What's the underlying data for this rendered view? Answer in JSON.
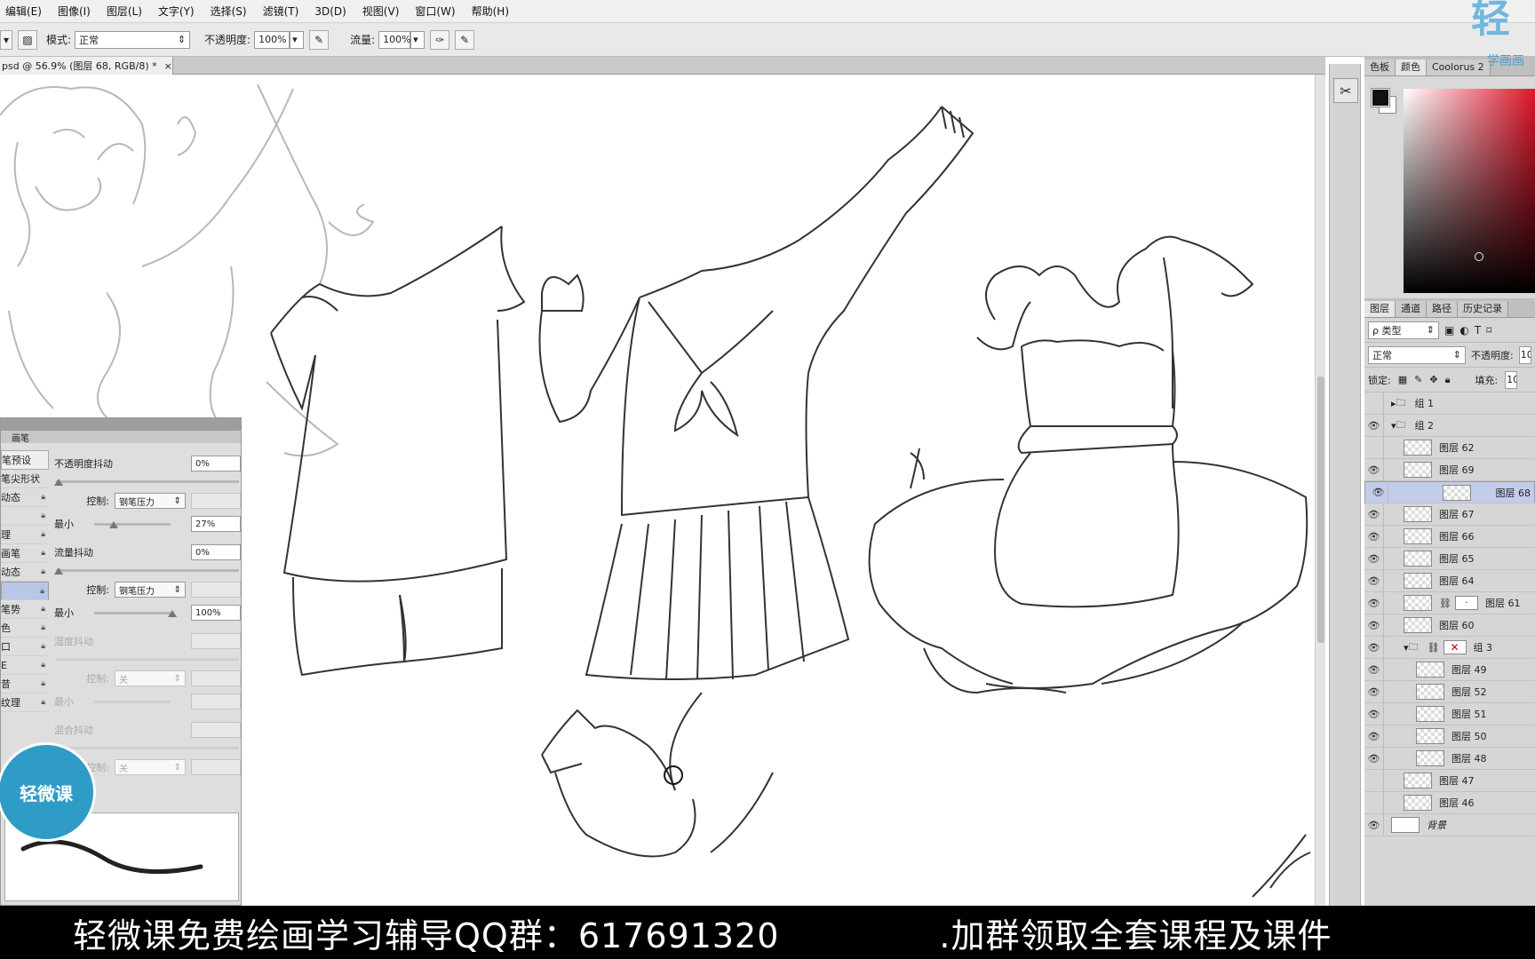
{
  "menu": [
    "编辑(E)",
    "图像(I)",
    "图层(L)",
    "文字(Y)",
    "选择(S)",
    "滤镜(T)",
    "3D(D)",
    "视图(V)",
    "窗口(W)",
    "帮助(H)"
  ],
  "options": {
    "mode_label": "模式:",
    "mode_value": "正常",
    "opacity_label": "不透明度:",
    "opacity_value": "100%",
    "flow_label": "流量:",
    "flow_value": "100%"
  },
  "document_tab": {
    "title": "psd @ 56.9% (图层 68, RGB/8) *",
    "close": "×"
  },
  "color_panel": {
    "tabs": [
      "色板",
      "颜色",
      "Coolorus 2"
    ],
    "active_tab": 1,
    "fg_color": "#111111",
    "bg_color": "#ffffff",
    "hue_color": "#e0152a"
  },
  "layers_panel": {
    "tabs": [
      "图层",
      "通道",
      "路径",
      "历史记录"
    ],
    "filter_label": "ρ 类型",
    "blend_mode": "正常",
    "opacity_label": "不透明度:",
    "opacity_value": "10",
    "lock_label": "锁定:",
    "fill_label": "填充:",
    "fill_value": "10",
    "layers": [
      {
        "name": "组 1",
        "type": "group",
        "visible": false,
        "indent": 0,
        "expanded": false
      },
      {
        "name": "组 2",
        "type": "group",
        "visible": true,
        "indent": 0,
        "expanded": true
      },
      {
        "name": "图层 62",
        "type": "layer",
        "visible": false,
        "indent": 1
      },
      {
        "name": "图层 69",
        "type": "layer",
        "visible": true,
        "indent": 1
      },
      {
        "name": "图层 68",
        "type": "layer",
        "visible": true,
        "indent": 1,
        "selected": true
      },
      {
        "name": "图层 67",
        "type": "layer",
        "visible": true,
        "indent": 1
      },
      {
        "name": "图层 66",
        "type": "layer",
        "visible": true,
        "indent": 1
      },
      {
        "name": "图层 65",
        "type": "layer",
        "visible": true,
        "indent": 1
      },
      {
        "name": "图层 64",
        "type": "layer",
        "visible": true,
        "indent": 1
      },
      {
        "name": "图层 61",
        "type": "masked",
        "visible": true,
        "indent": 1
      },
      {
        "name": "图层 60",
        "type": "layer",
        "visible": true,
        "indent": 1
      },
      {
        "name": "组 3",
        "type": "group-masked",
        "visible": true,
        "indent": 1,
        "expanded": true
      },
      {
        "name": "图层 49",
        "type": "layer",
        "visible": true,
        "indent": 2
      },
      {
        "name": "图层 52",
        "type": "layer",
        "visible": true,
        "indent": 2
      },
      {
        "name": "图层 51",
        "type": "layer",
        "visible": true,
        "indent": 2
      },
      {
        "name": "图层 50",
        "type": "layer",
        "visible": true,
        "indent": 2
      },
      {
        "name": "图层 48",
        "type": "layer",
        "visible": true,
        "indent": 2
      },
      {
        "name": "图层 47",
        "type": "layer",
        "visible": false,
        "indent": 1
      },
      {
        "name": "图层 46",
        "type": "layer",
        "visible": false,
        "indent": 1
      },
      {
        "name": "背景",
        "type": "background",
        "visible": true,
        "indent": 0
      }
    ]
  },
  "brush_panel": {
    "tab": "画笔",
    "preset_button": "笔预设",
    "categories": [
      {
        "label": "笔尖形状",
        "lock": false
      },
      {
        "label": "动态",
        "lock": true
      },
      {
        "label": "",
        "lock": true
      },
      {
        "label": "理",
        "lock": true
      },
      {
        "label": "画笔",
        "lock": true
      },
      {
        "label": "动态",
        "lock": true
      },
      {
        "label": "",
        "lock": true,
        "selected": true
      },
      {
        "label": "笔势",
        "lock": true
      },
      {
        "label": "色",
        "lock": true
      },
      {
        "label": "口",
        "lock": true
      },
      {
        "label": "E",
        "lock": true
      },
      {
        "label": "昔",
        "lock": true
      },
      {
        "label": "纹理",
        "lock": true
      }
    ],
    "opacity_jitter_label": "不透明度抖动",
    "opacity_jitter_value": "0%",
    "control_label": "控制:",
    "control_value": "钢笔压力",
    "min_label": "最小",
    "min1_value": "27%",
    "min1_fraction": 0.27,
    "flow_jitter_label": "流量抖动",
    "flow_jitter_value": "0%",
    "control2_value": "钢笔压力",
    "min2_value": "100%",
    "min2_fraction": 1.0,
    "wet_jitter_label": "湿度抖动",
    "control3_value": "关",
    "mix_jitter_label": "混合抖动",
    "control4_value": "关"
  },
  "logo_text": "轻微课",
  "watermark": {
    "big": "轻",
    "small": "学画画"
  },
  "banner": {
    "left": "轻微课免费绘画学习辅导QQ群：617691320",
    "right": ".加群领取全套课程及课件"
  }
}
